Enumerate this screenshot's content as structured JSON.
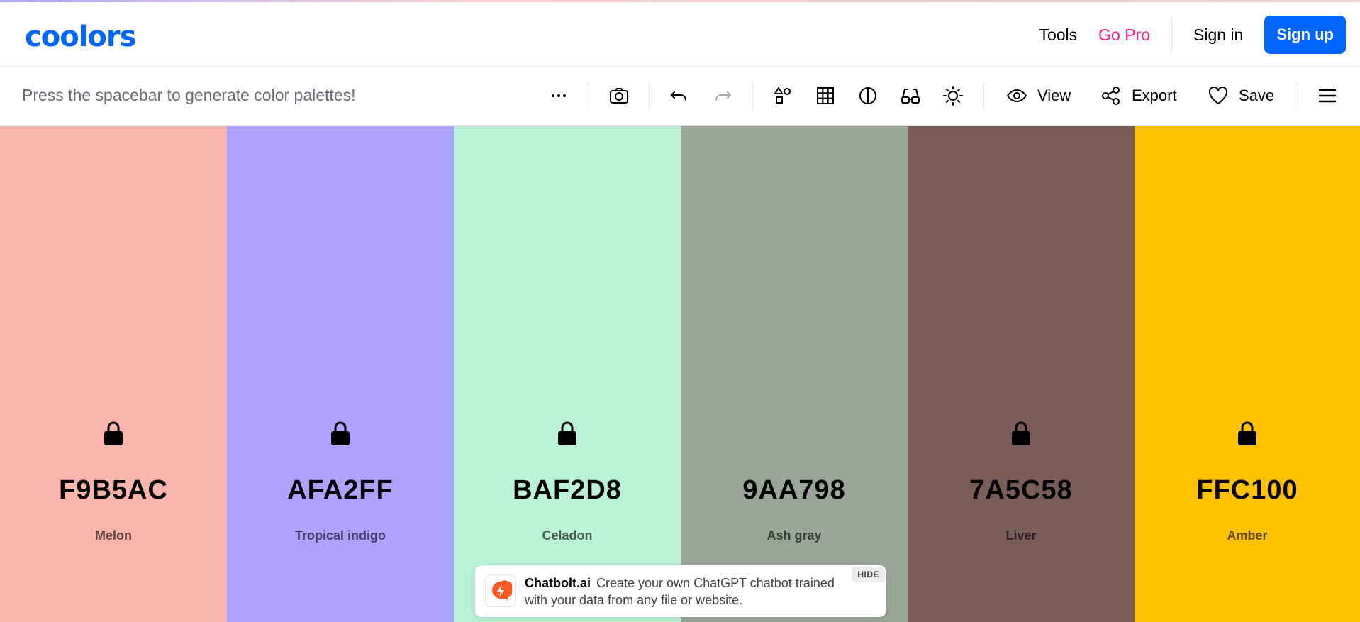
{
  "header": {
    "logo": "coolors",
    "nav": {
      "tools": "Tools",
      "go_pro": "Go Pro",
      "sign_in": "Sign in",
      "sign_up": "Sign up"
    }
  },
  "toolbar": {
    "hint": "Press the spacebar to generate color palettes!",
    "view": "View",
    "export": "Export",
    "save": "Save"
  },
  "palette": [
    {
      "hex": "F9B5AC",
      "name": "Melon",
      "color": "#F9B5AC",
      "locked": true
    },
    {
      "hex": "AFA2FF",
      "name": "Tropical indigo",
      "color": "#AFA2FF",
      "locked": true
    },
    {
      "hex": "BAF2D8",
      "name": "Celadon",
      "color": "#BAF2D8",
      "locked": true
    },
    {
      "hex": "9AA798",
      "name": "Ash gray",
      "color": "#9AA798",
      "locked": false
    },
    {
      "hex": "7A5C58",
      "name": "Liver",
      "color": "#7A5C58",
      "locked": true
    },
    {
      "hex": "FFC100",
      "name": "Amber",
      "color": "#FFC100",
      "locked": true
    }
  ],
  "ad": {
    "brand": "Chatbolt.ai",
    "text": "Create your own ChatGPT chatbot trained with your data from any file or website.",
    "hide": "HIDE"
  },
  "colors": {
    "brand": "#0066FF",
    "pro": "#FF1A8C"
  }
}
